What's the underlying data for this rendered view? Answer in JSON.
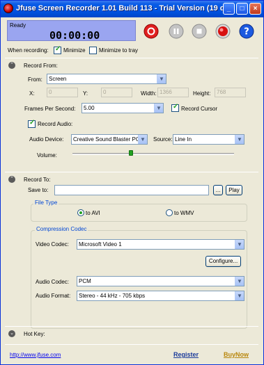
{
  "window": {
    "title": "Jfuse Screen Recorder 1.01 Build 113 - Trial Version (19 days ..."
  },
  "lcd": {
    "status": "Ready",
    "timer": "00:00:00"
  },
  "controls": {
    "record_color": "#e02020",
    "stop_color": "#b8b8b8"
  },
  "when_recording": {
    "label": "When recording:",
    "minimize_label": "Minimize",
    "minimize_checked": true,
    "minimize_tray_label": "Minimize to tray",
    "minimize_tray_checked": false
  },
  "record_from": {
    "section_label": "Record From:",
    "from_label": "From:",
    "from_value": "Screen",
    "x_label": "X:",
    "x_value": "0",
    "y_label": "Y:",
    "y_value": "0",
    "width_label": "Width:",
    "width_value": "1366",
    "height_label": "Height:",
    "height_value": "768",
    "fps_label": "Frames Per Second:",
    "fps_value": "5.00",
    "record_cursor_label": "Record Cursor",
    "record_audio_label": "Record Audio:",
    "audio_device_label": "Audio Device:",
    "audio_device_value": "Creative Sound Blaster PC",
    "source_label": "Source:",
    "source_value": "Line In",
    "volume_label": "Volume:",
    "volume_level": 0.36
  },
  "record_to": {
    "section_label": "Record To:",
    "save_to_label": "Save to:",
    "save_to_value": "",
    "browse_label": "...",
    "play_label": "Play",
    "file_type_title": "File Type",
    "to_avi_label": "to AVI",
    "to_wmv_label": "to WMV",
    "compression_title": "Compression Codec",
    "video_codec_label": "Video Codec:",
    "video_codec_value": "Microsoft Video 1",
    "configure_label": "Configure...",
    "audio_codec_label": "Audio Codec:",
    "audio_codec_value": "PCM",
    "audio_format_label": "Audio Format:",
    "audio_format_value": "Stereo - 44 kHz - 705 kbps"
  },
  "hotkey": {
    "section_label": "Hot Key:"
  },
  "footer": {
    "link": "http://www.jfuse.com",
    "register_label": "Register",
    "buynow_label": "BuyNow"
  },
  "colors": {
    "accent_blue": "#0046d5",
    "lcd_bg": "#9aa5f0",
    "register": "#1a3a9a",
    "buynow": "#b8860b"
  }
}
